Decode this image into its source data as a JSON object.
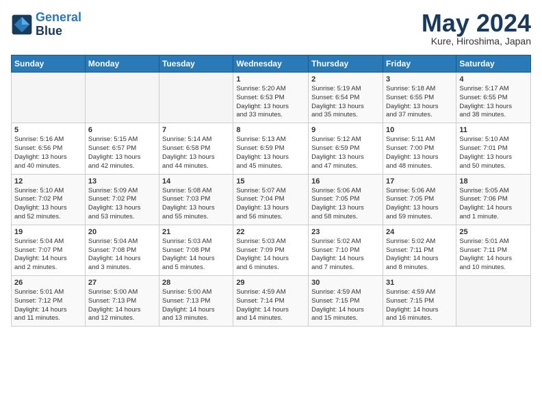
{
  "header": {
    "logo_line1": "General",
    "logo_line2": "Blue",
    "month": "May 2024",
    "location": "Kure, Hiroshima, Japan"
  },
  "weekdays": [
    "Sunday",
    "Monday",
    "Tuesday",
    "Wednesday",
    "Thursday",
    "Friday",
    "Saturday"
  ],
  "weeks": [
    [
      {
        "day": "",
        "info": ""
      },
      {
        "day": "",
        "info": ""
      },
      {
        "day": "",
        "info": ""
      },
      {
        "day": "1",
        "info": "Sunrise: 5:20 AM\nSunset: 6:53 PM\nDaylight: 13 hours\nand 33 minutes."
      },
      {
        "day": "2",
        "info": "Sunrise: 5:19 AM\nSunset: 6:54 PM\nDaylight: 13 hours\nand 35 minutes."
      },
      {
        "day": "3",
        "info": "Sunrise: 5:18 AM\nSunset: 6:55 PM\nDaylight: 13 hours\nand 37 minutes."
      },
      {
        "day": "4",
        "info": "Sunrise: 5:17 AM\nSunset: 6:55 PM\nDaylight: 13 hours\nand 38 minutes."
      }
    ],
    [
      {
        "day": "5",
        "info": "Sunrise: 5:16 AM\nSunset: 6:56 PM\nDaylight: 13 hours\nand 40 minutes."
      },
      {
        "day": "6",
        "info": "Sunrise: 5:15 AM\nSunset: 6:57 PM\nDaylight: 13 hours\nand 42 minutes."
      },
      {
        "day": "7",
        "info": "Sunrise: 5:14 AM\nSunset: 6:58 PM\nDaylight: 13 hours\nand 44 minutes."
      },
      {
        "day": "8",
        "info": "Sunrise: 5:13 AM\nSunset: 6:59 PM\nDaylight: 13 hours\nand 45 minutes."
      },
      {
        "day": "9",
        "info": "Sunrise: 5:12 AM\nSunset: 6:59 PM\nDaylight: 13 hours\nand 47 minutes."
      },
      {
        "day": "10",
        "info": "Sunrise: 5:11 AM\nSunset: 7:00 PM\nDaylight: 13 hours\nand 48 minutes."
      },
      {
        "day": "11",
        "info": "Sunrise: 5:10 AM\nSunset: 7:01 PM\nDaylight: 13 hours\nand 50 minutes."
      }
    ],
    [
      {
        "day": "12",
        "info": "Sunrise: 5:10 AM\nSunset: 7:02 PM\nDaylight: 13 hours\nand 52 minutes."
      },
      {
        "day": "13",
        "info": "Sunrise: 5:09 AM\nSunset: 7:02 PM\nDaylight: 13 hours\nand 53 minutes."
      },
      {
        "day": "14",
        "info": "Sunrise: 5:08 AM\nSunset: 7:03 PM\nDaylight: 13 hours\nand 55 minutes."
      },
      {
        "day": "15",
        "info": "Sunrise: 5:07 AM\nSunset: 7:04 PM\nDaylight: 13 hours\nand 56 minutes."
      },
      {
        "day": "16",
        "info": "Sunrise: 5:06 AM\nSunset: 7:05 PM\nDaylight: 13 hours\nand 58 minutes."
      },
      {
        "day": "17",
        "info": "Sunrise: 5:06 AM\nSunset: 7:05 PM\nDaylight: 13 hours\nand 59 minutes."
      },
      {
        "day": "18",
        "info": "Sunrise: 5:05 AM\nSunset: 7:06 PM\nDaylight: 14 hours\nand 1 minute."
      }
    ],
    [
      {
        "day": "19",
        "info": "Sunrise: 5:04 AM\nSunset: 7:07 PM\nDaylight: 14 hours\nand 2 minutes."
      },
      {
        "day": "20",
        "info": "Sunrise: 5:04 AM\nSunset: 7:08 PM\nDaylight: 14 hours\nand 3 minutes."
      },
      {
        "day": "21",
        "info": "Sunrise: 5:03 AM\nSunset: 7:08 PM\nDaylight: 14 hours\nand 5 minutes."
      },
      {
        "day": "22",
        "info": "Sunrise: 5:03 AM\nSunset: 7:09 PM\nDaylight: 14 hours\nand 6 minutes."
      },
      {
        "day": "23",
        "info": "Sunrise: 5:02 AM\nSunset: 7:10 PM\nDaylight: 14 hours\nand 7 minutes."
      },
      {
        "day": "24",
        "info": "Sunrise: 5:02 AM\nSunset: 7:11 PM\nDaylight: 14 hours\nand 8 minutes."
      },
      {
        "day": "25",
        "info": "Sunrise: 5:01 AM\nSunset: 7:11 PM\nDaylight: 14 hours\nand 10 minutes."
      }
    ],
    [
      {
        "day": "26",
        "info": "Sunrise: 5:01 AM\nSunset: 7:12 PM\nDaylight: 14 hours\nand 11 minutes."
      },
      {
        "day": "27",
        "info": "Sunrise: 5:00 AM\nSunset: 7:13 PM\nDaylight: 14 hours\nand 12 minutes."
      },
      {
        "day": "28",
        "info": "Sunrise: 5:00 AM\nSunset: 7:13 PM\nDaylight: 14 hours\nand 13 minutes."
      },
      {
        "day": "29",
        "info": "Sunrise: 4:59 AM\nSunset: 7:14 PM\nDaylight: 14 hours\nand 14 minutes."
      },
      {
        "day": "30",
        "info": "Sunrise: 4:59 AM\nSunset: 7:15 PM\nDaylight: 14 hours\nand 15 minutes."
      },
      {
        "day": "31",
        "info": "Sunrise: 4:59 AM\nSunset: 7:15 PM\nDaylight: 14 hours\nand 16 minutes."
      },
      {
        "day": "",
        "info": ""
      }
    ]
  ]
}
